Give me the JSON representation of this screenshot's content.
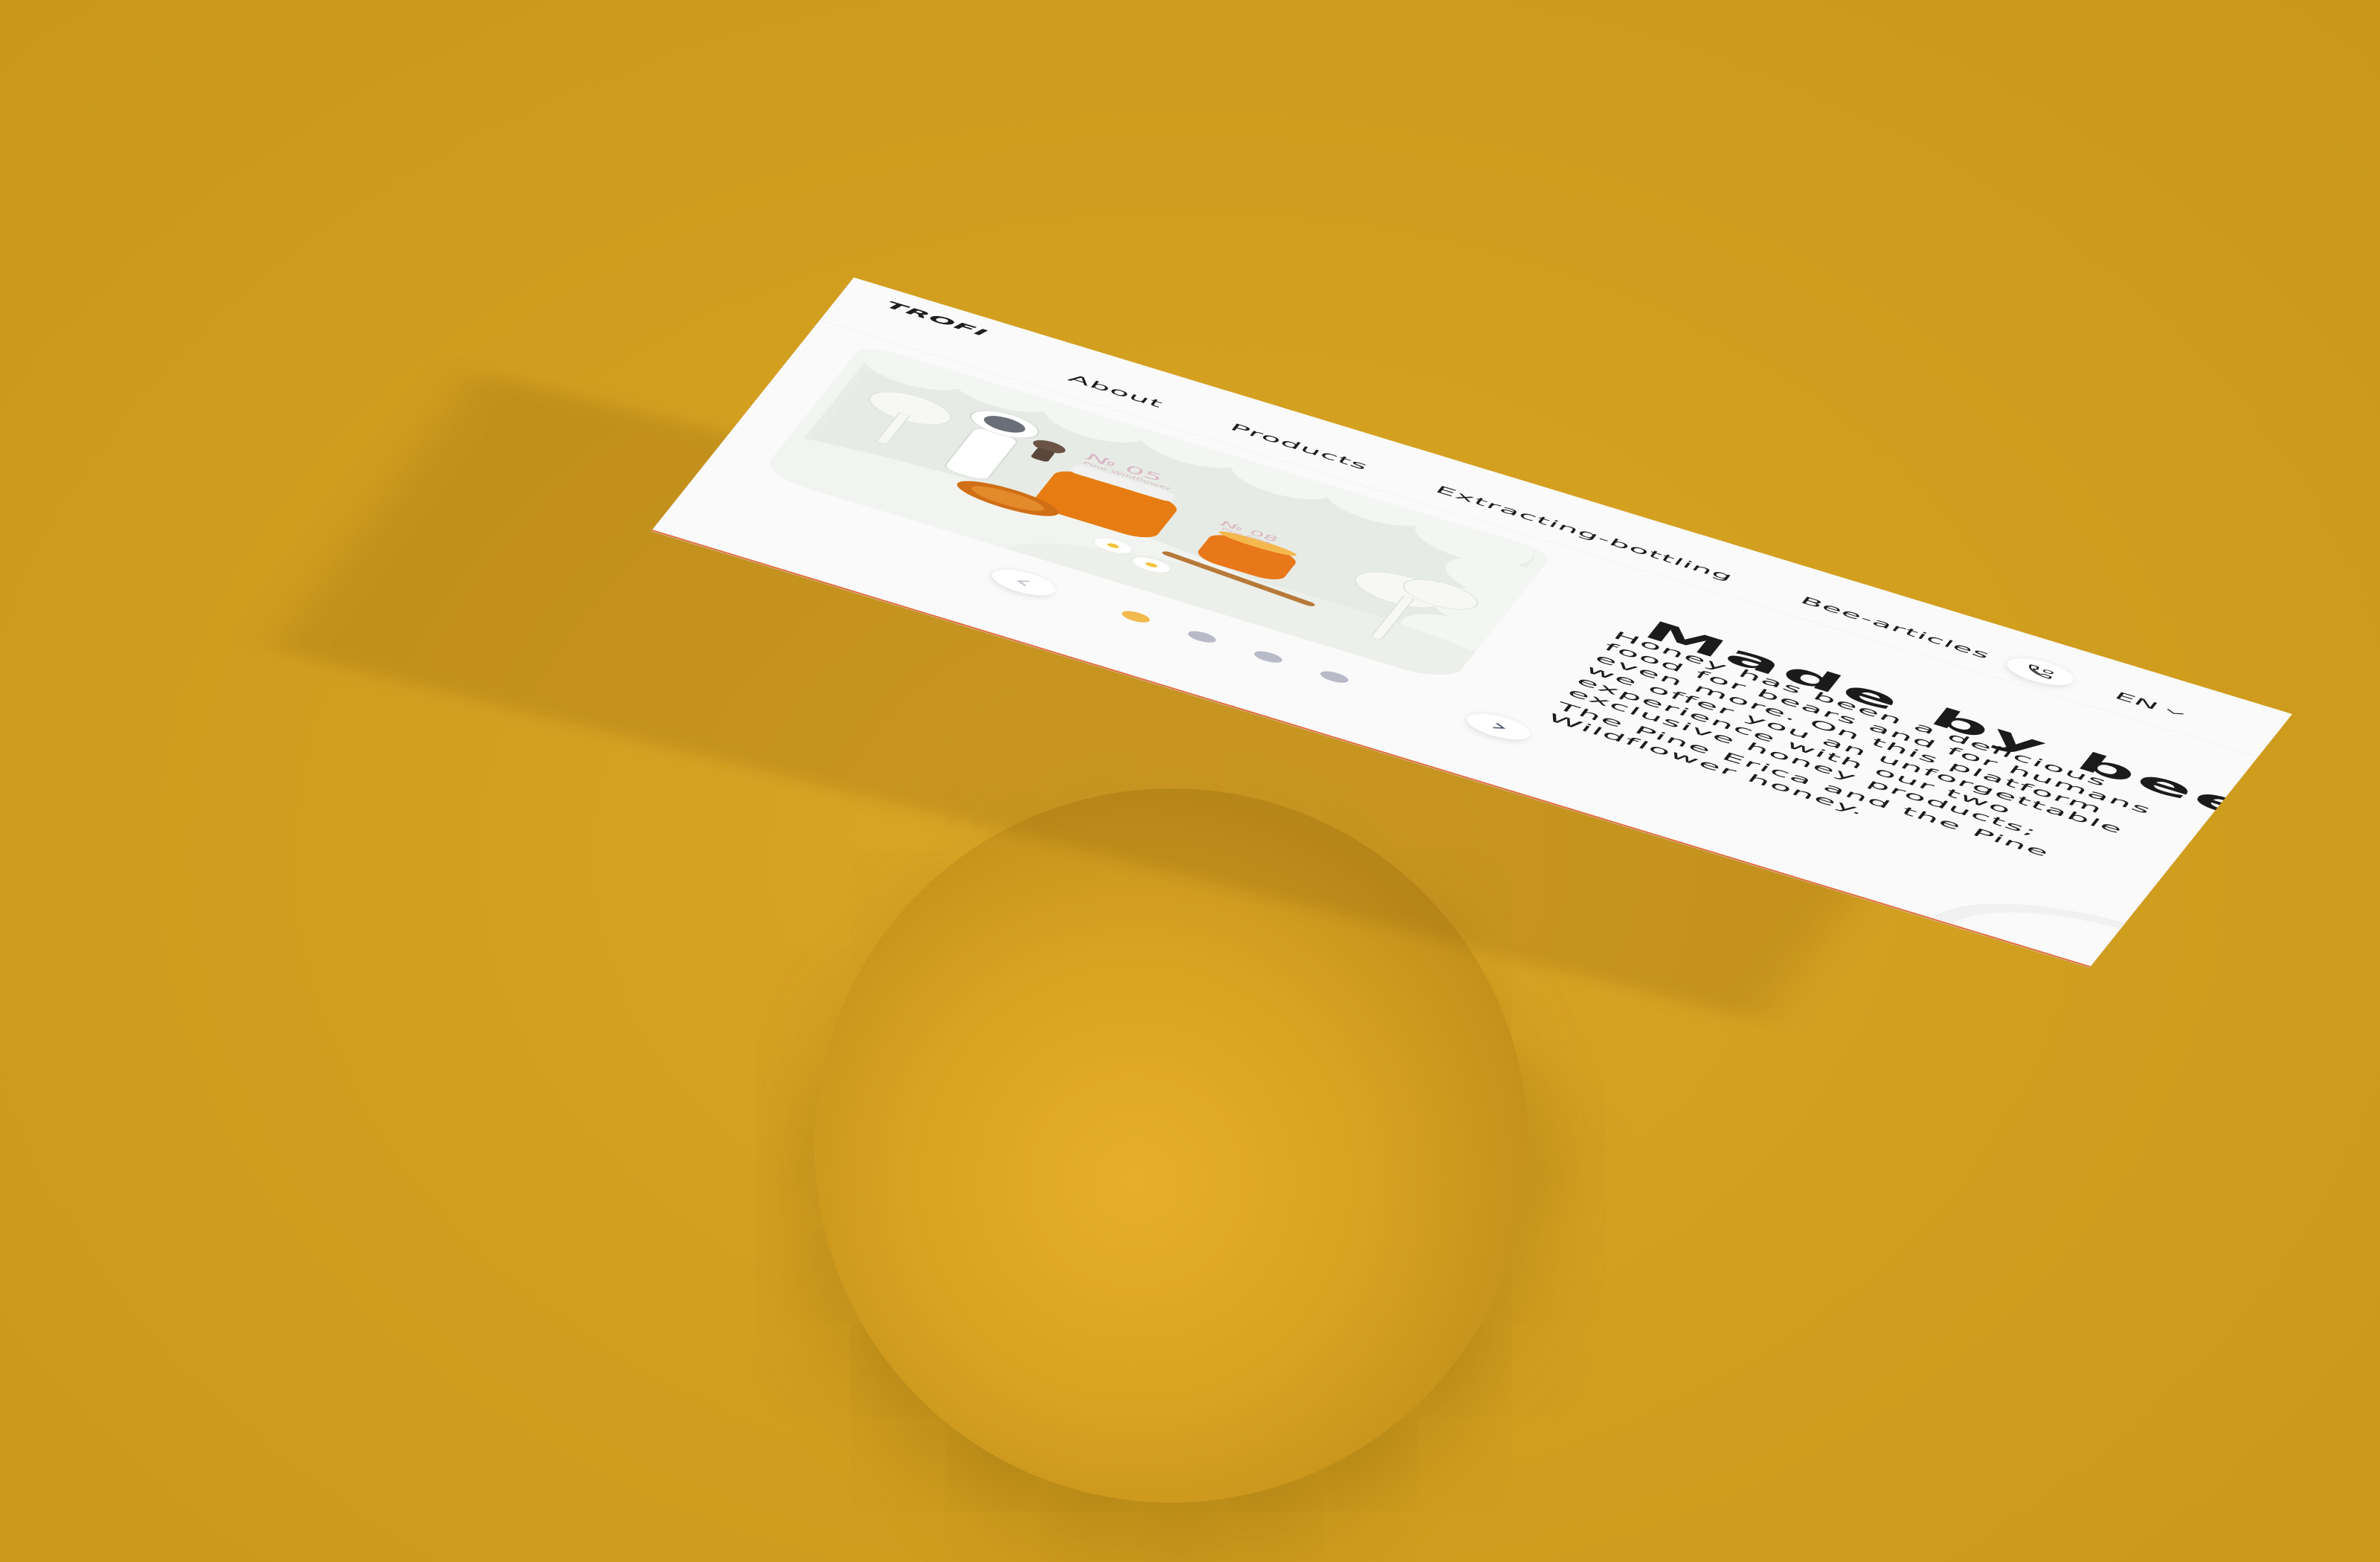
{
  "brand": {
    "logo_text": "TROFI"
  },
  "nav": {
    "items": [
      {
        "label": "About"
      },
      {
        "label": "Products"
      },
      {
        "label": "Extracting-bottling"
      },
      {
        "label": "Bee-articles"
      }
    ]
  },
  "header": {
    "phone_icon": "phone-icon",
    "language": {
      "selected": "EN",
      "icon": "chevron-down-icon"
    }
  },
  "hero": {
    "jar_large_label": "№ 05",
    "jar_large_sub": "Pine Wildflower",
    "jar_small_label": "№ 08",
    "jar_small_sub": "Pine Erica"
  },
  "slider": {
    "prev_icon": "chevron-left-icon",
    "next_icon": "chevron-right-icon",
    "active_index": 0,
    "dot_count": 4
  },
  "content": {
    "title": "Made by bees",
    "paragraph_1": "Honey has been a delicious food for bears and for humans even more. On this platform we offer you an unforgettable experience with our two exclusive honey products;",
    "paragraph_2": "The Pine Erica and the Pine Wildflower honey."
  },
  "colors": {
    "background": "#d29f1f",
    "accent_active_dot": "#f2b94e",
    "inactive_dot": "#b8bac8",
    "card_edge": "#e76b30",
    "text": "#1b1b1b"
  }
}
